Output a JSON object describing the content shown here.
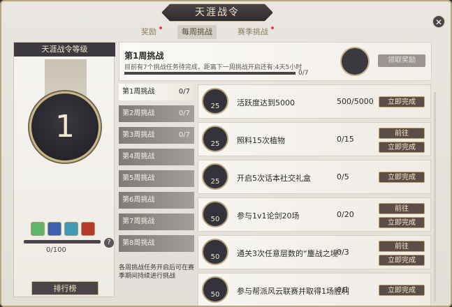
{
  "window": {
    "title": "天涯战令",
    "close_symbol": "✕"
  },
  "tabs": [
    {
      "label": "奖励",
      "has_dot": true
    },
    {
      "label": "每周挑战",
      "has_dot": false
    },
    {
      "label": "赛季挑战",
      "has_dot": true
    }
  ],
  "left_panel": {
    "header": "天涯战令等级",
    "level": "1",
    "progress_text": "0/100",
    "rank_button": "排行榜",
    "help_icon": "?"
  },
  "week_header": {
    "title": "第1周挑战",
    "description": "目前有7个挑战任务待完成，距离下一周挑战开启还有:4天5小时",
    "progress": "0/7",
    "claim_button": "领取奖励"
  },
  "weeks": [
    {
      "label": "第1周挑战",
      "count": "0/7"
    },
    {
      "label": "第2周挑战",
      "count": "0/7"
    },
    {
      "label": "第3周挑战",
      "count": "0/7"
    },
    {
      "label": "第4周挑战",
      "count": ""
    },
    {
      "label": "第5周挑战",
      "count": ""
    },
    {
      "label": "第6周挑战",
      "count": ""
    },
    {
      "label": "第7周挑战",
      "count": ""
    },
    {
      "label": "第8周挑战",
      "count": ""
    }
  ],
  "week_note": "各周挑战任务开启后可在赛季期间持续进行挑战",
  "tasks": [
    {
      "icon_value": "25",
      "name": "活跃度达到5000",
      "progress": "500/5000",
      "buttons": [
        "立即完成"
      ]
    },
    {
      "icon_value": "25",
      "name": "照料15次植物",
      "progress": "0/15",
      "buttons": [
        "前往",
        "立即完成"
      ]
    },
    {
      "icon_value": "25",
      "name": "开启5次话本社交礼盒",
      "progress": "0/5",
      "buttons": [
        "立即完成"
      ]
    },
    {
      "icon_value": "50",
      "name": "参与1v1论剑20场",
      "progress": "0/20",
      "buttons": [
        "前往",
        "立即完成"
      ]
    },
    {
      "icon_value": "50",
      "name": "通关3次任意层数的“鏖战之境”",
      "progress": "0/3",
      "buttons": [
        "前往",
        "立即完成"
      ]
    },
    {
      "icon_value": "50",
      "name": "参与帮派风云联赛并取得1场胜利",
      "progress": "0/1",
      "buttons": [
        "立即完成"
      ]
    }
  ]
}
